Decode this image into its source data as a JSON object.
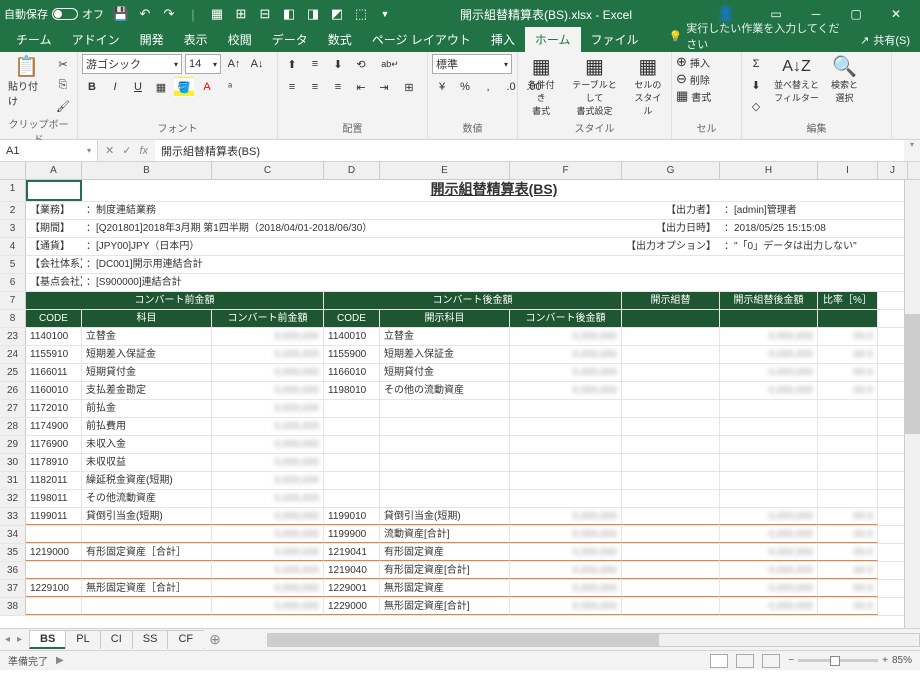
{
  "titlebar": {
    "autosave_label": "自動保存",
    "autosave_state": "オフ",
    "title": "開示組替精算表(BS).xlsx - Excel"
  },
  "tabs": [
    "ファイル",
    "ホーム",
    "挿入",
    "ページ レイアウト",
    "数式",
    "データ",
    "校閲",
    "表示",
    "開発",
    "アドイン",
    "チーム"
  ],
  "tellme": "実行したい作業を入力してください",
  "share": "共有(S)",
  "ribbon": {
    "clipboard": {
      "paste": "貼り付け",
      "label": "クリップボード"
    },
    "font": {
      "name": "游ゴシック",
      "size": "14",
      "label": "フォント"
    },
    "align": {
      "label": "配置"
    },
    "number": {
      "style": "標準",
      "label": "数値"
    },
    "styles": {
      "cond": "条件付き\n書式",
      "table": "テーブルとして\n書式設定",
      "cell": "セルの\nスタイル",
      "label": "スタイル"
    },
    "cells": {
      "insert": "挿入",
      "delete": "削除",
      "format": "書式",
      "label": "セル"
    },
    "editing": {
      "sort": "並べ替えと\nフィルター",
      "find": "検索と\n選択",
      "label": "編集"
    }
  },
  "namebox": {
    "ref": "A1",
    "formula": "開示組替精算表(BS)"
  },
  "cols": [
    "A",
    "B",
    "C",
    "D",
    "E",
    "F",
    "G",
    "H",
    "I",
    "J"
  ],
  "sheet": {
    "title": "開示組替精算表(BS)",
    "meta": [
      {
        "row": 2,
        "label": "【業務】",
        "value": "：制度連結業務",
        "right_l": "【出力者】",
        "right_v": "：[admin]管理者"
      },
      {
        "row": 3,
        "label": "【期間】",
        "value": "：[Q201801]2018年3月期 第1四半期（2018/04/01-2018/06/30）",
        "right_l": "【出力日時】",
        "right_v": "：2018/05/25 15:15:08"
      },
      {
        "row": 4,
        "label": "【通貨】",
        "value": "：[JPY00]JPY（日本円）",
        "right_l": "【出力オプション】",
        "right_v": "：\"「0」データは出力しない\""
      },
      {
        "row": 5,
        "label": "【会社体系】",
        "value": "：[DC001]開示用連結合計"
      },
      {
        "row": 6,
        "label": "【基点会社】",
        "value": "：[S900000]連結合計"
      }
    ],
    "header1": {
      "before": "コンバート前金額",
      "after": "コンバート後金額",
      "kaiji": "開示組替",
      "kaijigo": "開示組替後金額",
      "ratio": "比率［%］"
    },
    "header2": {
      "code": "CODE",
      "kamoku": "科目",
      "beforeamt": "コンバート前金額",
      "code2": "CODE",
      "kaijikamoku": "開示科目",
      "afteramt": "コンバート後金額"
    },
    "rows": [
      {
        "r": 23,
        "c1": "1140100",
        "c2": "立替金",
        "c4": "1140010",
        "c5": "立替金"
      },
      {
        "r": 24,
        "c1": "1155910",
        "c2": "短期差入保証金",
        "c4": "1155900",
        "c5": "短期差入保証金"
      },
      {
        "r": 25,
        "c1": "1166011",
        "c2": "短期貸付金",
        "c4": "1166010",
        "c5": "短期貸付金"
      },
      {
        "r": 26,
        "c1": "1160010",
        "c2": "支払差金勘定",
        "c4": "1198010",
        "c5": "その他の流動資産"
      },
      {
        "r": 27,
        "c1": "1172010",
        "c2": "前払金"
      },
      {
        "r": 28,
        "c1": "1174900",
        "c2": "前払費用"
      },
      {
        "r": 29,
        "c1": "1176900",
        "c2": "未収入金"
      },
      {
        "r": 30,
        "c1": "1178910",
        "c2": "未収収益"
      },
      {
        "r": 31,
        "c1": "1182011",
        "c2": "繰延税金資産(短期)"
      },
      {
        "r": 32,
        "c1": "1198011",
        "c2": "その他流動資産"
      },
      {
        "r": 33,
        "c1": "1199011",
        "c2": "貸倒引当金(短期)",
        "c4": "1199010",
        "c5": "貸倒引当金(短期)",
        "orange": true
      },
      {
        "r": 34,
        "c4": "1199900",
        "c5": "流動資産[合計]",
        "orange": true
      },
      {
        "r": 35,
        "c1": "1219000",
        "c2": "有形固定資産［合計］",
        "c4": "1219041",
        "c5": "有形固定資産",
        "orange": true
      },
      {
        "r": 36,
        "c4": "1219040",
        "c5": "有形固定資産[合計]",
        "orange": true
      },
      {
        "r": 37,
        "c1": "1229100",
        "c2": "無形固定資産［合計］",
        "c4": "1229001",
        "c5": "無形固定資産",
        "orange": true
      },
      {
        "r": 38,
        "c4": "1229000",
        "c5": "無形固定資産[合計]",
        "orange": true
      }
    ]
  },
  "sheets": [
    "BS",
    "PL",
    "CI",
    "SS",
    "CF"
  ],
  "status": {
    "ready": "準備完了",
    "zoom": "85%"
  }
}
